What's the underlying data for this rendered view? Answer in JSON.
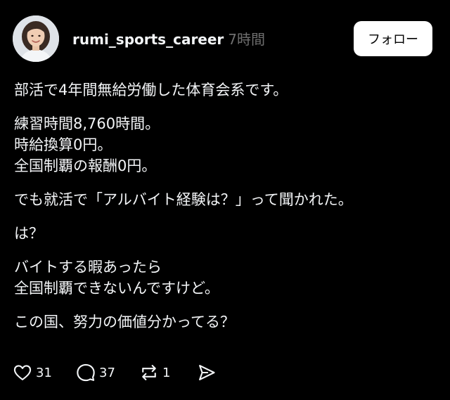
{
  "post": {
    "author": {
      "username": "rumi_sports_career",
      "timestamp": "7時間",
      "avatar_icon": "profile-photo"
    },
    "follow_label": "フォロー",
    "paragraphs": [
      {
        "lines": [
          "部活で4年間無給労働した体育会系です。"
        ]
      },
      {
        "lines": [
          "練習時間8,760時間。",
          "時給換算0円。",
          "全国制覇の報酬0円。"
        ]
      },
      {
        "lines": [
          "でも就活で「アルバイト経験は？」って聞かれた。"
        ]
      },
      {
        "lines": [
          "は？"
        ]
      },
      {
        "lines": [
          "バイトする暇あったら",
          "全国制覇できないんですけど。"
        ]
      },
      {
        "lines": [
          "この国、努力の価値分かってる？"
        ]
      }
    ],
    "actions": {
      "like": {
        "icon": "heart-icon",
        "count": "31"
      },
      "comment": {
        "icon": "comment-icon",
        "count": "37"
      },
      "repost": {
        "icon": "repost-icon",
        "count": "1"
      },
      "share": {
        "icon": "send-icon"
      }
    }
  },
  "colors": {
    "background": "#000000",
    "text": "#f3f5f7",
    "muted": "#6f6f6f",
    "button_bg": "#ffffff",
    "button_text": "#000000"
  }
}
